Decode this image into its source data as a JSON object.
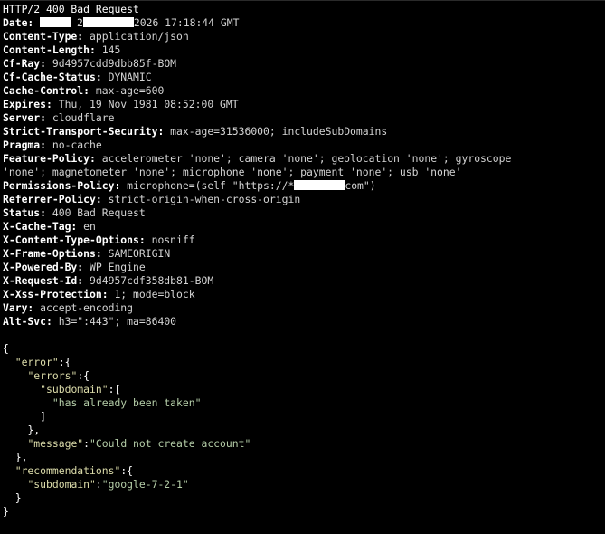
{
  "response": {
    "status_line": "HTTP/2 400 Bad Request",
    "date": {
      "name": "Date:",
      "part1": "2",
      "part2": "2026 17:18:44 GMT"
    },
    "headers": [
      {
        "name": "Content-Type:",
        "value": "application/json"
      },
      {
        "name": "Content-Length:",
        "value": "145"
      },
      {
        "name": "Cf-Ray:",
        "value": "9d4957cdd9dbb85f-BOM"
      },
      {
        "name": "Cf-Cache-Status:",
        "value": "DYNAMIC"
      },
      {
        "name": "Cache-Control:",
        "value": "max-age=600"
      },
      {
        "name": "Expires:",
        "value": "Thu, 19 Nov 1981 08:52:00 GMT"
      },
      {
        "name": "Server:",
        "value": "cloudflare"
      },
      {
        "name": "Strict-Transport-Security:",
        "value": "max-age=31536000; includeSubDomains"
      },
      {
        "name": "Pragma:",
        "value": "no-cache"
      },
      {
        "name": "Feature-Policy:",
        "value": "accelerometer 'none'; camera 'none'; geolocation 'none'; gyroscope"
      },
      {
        "name": "",
        "value": "'none'; magnetometer 'none'; microphone 'none'; payment 'none'; usb 'none'"
      },
      {
        "name": "Permissions-Policy:",
        "value": "microphone=(self \"https://*",
        "redacted": true,
        "suffix": "com\")"
      },
      {
        "name": "Referrer-Policy:",
        "value": "strict-origin-when-cross-origin"
      },
      {
        "name": "Status:",
        "value": "400 Bad Request"
      },
      {
        "name": "X-Cache-Tag:",
        "value": "en"
      },
      {
        "name": "X-Content-Type-Options:",
        "value": "nosniff"
      },
      {
        "name": "X-Frame-Options:",
        "value": "SAMEORIGIN"
      },
      {
        "name": "X-Powered-By:",
        "value": "WP Engine"
      },
      {
        "name": "X-Request-Id:",
        "value": "9d4957cdf358db81-BOM"
      },
      {
        "name": "X-Xss-Protection:",
        "value": "1; mode=block"
      },
      {
        "name": "Vary:",
        "value": "accept-encoding"
      },
      {
        "name": "Alt-Svc:",
        "value": "h3=\":443\"; ma=86400"
      }
    ]
  },
  "body": {
    "open_brace": "{",
    "close_brace": "}",
    "error_key": "\"error\"",
    "errors_key": "\"errors\"",
    "subdomain_key": "\"subdomain\"",
    "subdomain_error": "\"has already been taken\"",
    "message_key": "\"message\"",
    "message_value": "\"Could not create account\"",
    "recommendations_key": "\"recommendations\"",
    "recommendation_value": "\"google-7-2-1\"",
    "colon_brace": ":{",
    "colon_bracket": ":[",
    "close_bracket": "]",
    "close_brace_comma": "},",
    "colon": ":"
  }
}
